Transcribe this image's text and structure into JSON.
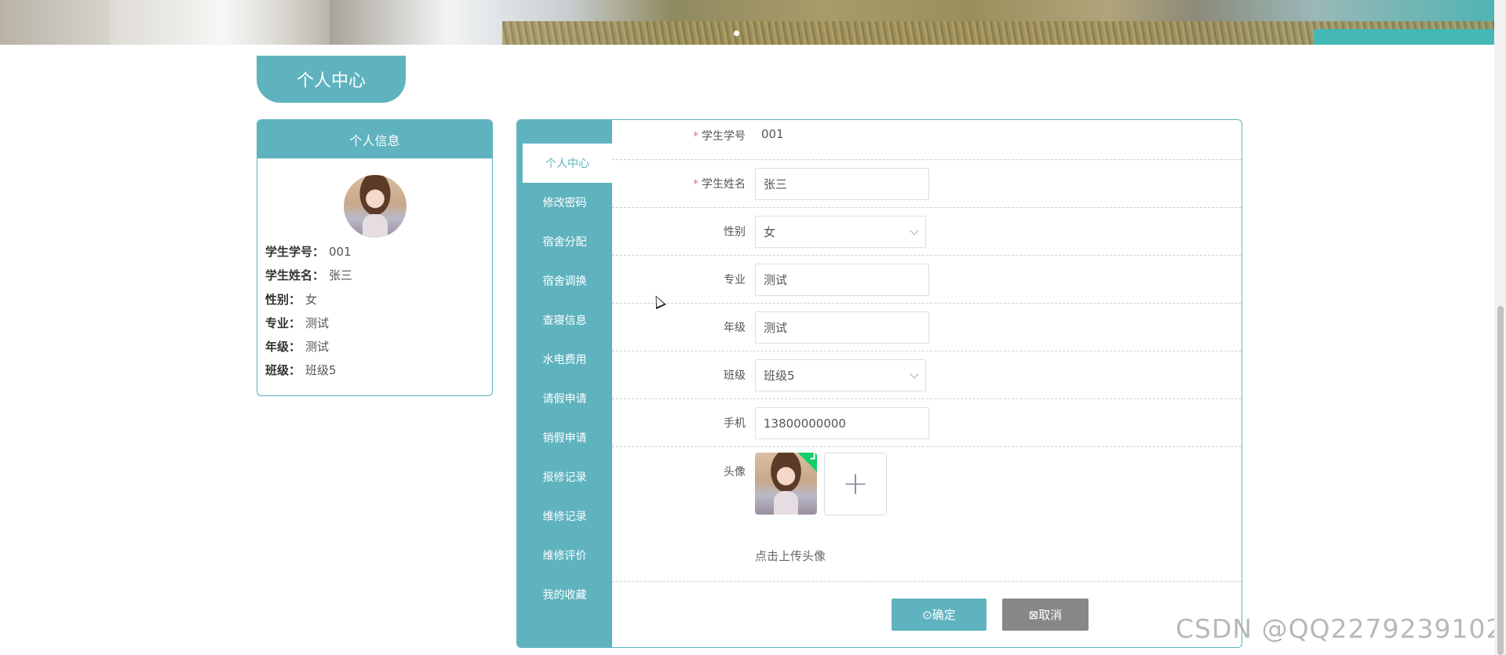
{
  "page_title": "个人中心",
  "info_card": {
    "title": "个人信息",
    "rows": [
      {
        "label": "学生学号：",
        "value": "001"
      },
      {
        "label": "学生姓名：",
        "value": "张三"
      },
      {
        "label": "性别：",
        "value": "女"
      },
      {
        "label": "专业：",
        "value": "测试"
      },
      {
        "label": "年级：",
        "value": "测试"
      },
      {
        "label": "班级：",
        "value": "班级5"
      }
    ]
  },
  "nav": [
    {
      "label": "个人中心",
      "active": true
    },
    {
      "label": "修改密码"
    },
    {
      "label": "宿舍分配"
    },
    {
      "label": "宿舍调换"
    },
    {
      "label": "查寝信息"
    },
    {
      "label": "水电费用"
    },
    {
      "label": "请假申请"
    },
    {
      "label": "销假申请"
    },
    {
      "label": "报修记录"
    },
    {
      "label": "维修记录"
    },
    {
      "label": "维修评价"
    },
    {
      "label": "我的收藏"
    }
  ],
  "form": {
    "student_id": {
      "label": "学生学号",
      "required_mark": "*",
      "value": "001"
    },
    "student_name": {
      "label": "学生姓名",
      "required_mark": "*",
      "value": "张三"
    },
    "gender": {
      "label": "性别",
      "value": "女"
    },
    "major": {
      "label": "专业",
      "value": "测试"
    },
    "grade": {
      "label": "年级",
      "value": "测试"
    },
    "class": {
      "label": "班级",
      "value": "班级5"
    },
    "phone": {
      "label": "手机",
      "value": "13800000000"
    },
    "avatar": {
      "label": "头像",
      "add_symbol": "+",
      "tip": "点击上传头像"
    }
  },
  "buttons": {
    "confirm": "⊙确定",
    "cancel": "⊠取消"
  },
  "watermark": "CSDN @QQ2279239102",
  "colors": {
    "accent": "#5fb3bf",
    "cancel": "#888888",
    "required": "#f56c6c",
    "upload_success": "#13ce66"
  }
}
